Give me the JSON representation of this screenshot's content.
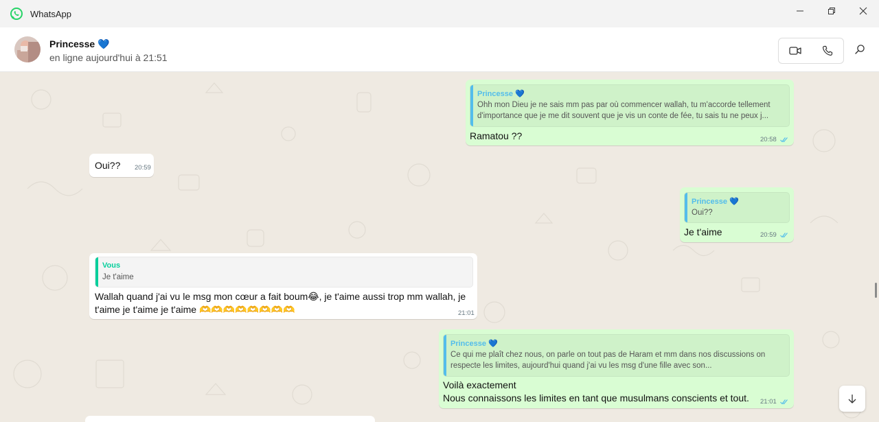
{
  "window": {
    "app_title": "WhatsApp",
    "logo_icon": "whatsapp-logo-icon",
    "controls": [
      "minimize-icon",
      "maximize-icon",
      "close-icon"
    ]
  },
  "header": {
    "contact_name": "Princesse 💙",
    "status": "en ligne aujourd'hui à 21:51",
    "actions": [
      "video-call-icon",
      "voice-call-icon",
      "search-icon"
    ]
  },
  "colors": {
    "outgoing_bubble": "#d9fdd3",
    "incoming_bubble": "#ffffff",
    "quote_princesse": "#53bdeb",
    "quote_vous": "#06cf9c",
    "read_ticks": "#53bdeb",
    "brand": "#25d366"
  },
  "messages": [
    {
      "direction": "out",
      "quote": {
        "author": "Princesse 💙",
        "text": "Ohh mon Dieu je ne sais mm pas par où commencer wallah, tu m'accorde tellement d'importance que je me dit souvent que je vis un conte de fée, tu sais tu ne peux j..."
      },
      "text": "Ramatou ??",
      "time": "20:58",
      "status": "read"
    },
    {
      "direction": "in",
      "text": "Oui??",
      "time": "20:59"
    },
    {
      "direction": "out",
      "quote": {
        "author": "Princesse 💙",
        "text": "Oui??"
      },
      "text": "Je t'aime",
      "time": "20:59",
      "status": "read"
    },
    {
      "direction": "in",
      "quote": {
        "author": "Vous",
        "text": "Je t'aime"
      },
      "text": "Wallah quand j'ai vu le msg mon cœur a fait boum😂, je t'aime aussi trop mm wallah, je t'aime je t'aime je t'aime 🫶🫶🫶🫶🫶🫶🫶🫶",
      "time": "21:01"
    },
    {
      "direction": "out",
      "quote": {
        "author": "Princesse 💙",
        "text": "Ce qui me plaît chez nous, on parle on tout pas de Haram et mm dans nos discussions on respecte les limites, aujourd'hui quand j'ai vu les msg d'une fille avec son..."
      },
      "text": "Voilà exactement\nNous connaissons les limites en tant que musulmans conscients et tout.",
      "time": "21:01",
      "status": "read"
    }
  ],
  "controls": {
    "scroll_down_icon": "arrow-down-icon"
  }
}
